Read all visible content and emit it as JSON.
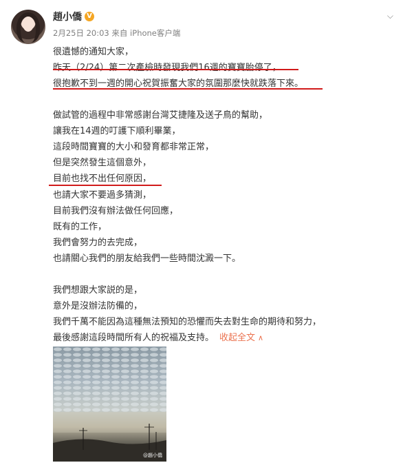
{
  "header": {
    "username": "趙小僑",
    "date": "2月25日 20:03",
    "source": "来自 iPhone客户端",
    "more_icon": "chevron-down-icon"
  },
  "post": {
    "lines": [
      "很遺憾的通知大家，",
      "昨天（2/24）第二次產檢時發現我們16週的寶寶胎停了，",
      "很抱歉不到一週的開心祝賀振奮大家的氛圍那麼快就跌落下來。",
      "",
      "做試管的過程中非常感謝台灣艾捷隆及送子鳥的幫助，",
      "讓我在14週的叮護下順利畢業，",
      "這段時間寶寶的大小和發育都非常正常，",
      "但是突然發生這個意外，",
      "目前也找不出任何原因，",
      "也請大家不要過多猜測，",
      "目前我們沒有辦法做任何回應，",
      "既有的工作，",
      "我們會努力的去完成，",
      "也請關心我們的朋友給我們一些時間沈澱一下。",
      "",
      "我們想跟大家説的是，",
      "意外是沒辦法防備的，",
      "我們千萬不能因為這種無法預知的恐懼而失去對生命的期待和努力，",
      "最後感謝這段時間所有人的祝福及支持。"
    ],
    "collapse_label": "收起全文",
    "collapse_icon": "chevron-up-icon"
  },
  "photo": {
    "watermark": "@趙小僑"
  },
  "colors": {
    "underline": "#d11a1a",
    "link": "#eb7350",
    "verified": "#f5a623"
  }
}
